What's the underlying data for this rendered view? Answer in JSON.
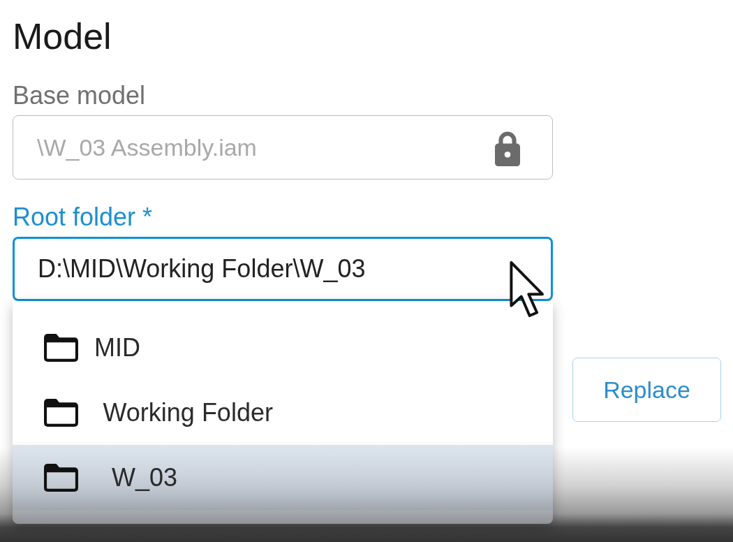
{
  "section": {
    "title": "Model"
  },
  "fields": [
    {
      "label": "Base model",
      "value": "\\W_03 Assembly.iam",
      "disabled": true,
      "focused": false
    },
    {
      "label": "Root folder *",
      "value": "D:\\MID\\Working Folder\\W_03",
      "disabled": false,
      "focused": true,
      "dropdown": {
        "items": [
          {
            "label": "MID",
            "selected": false,
            "children": [
              {
                "label": "Working Folder",
                "selected": false,
                "children": [
                  {
                    "label": "W_03",
                    "selected": true
                  }
                ]
              }
            ]
          }
        ]
      }
    }
  ],
  "actions": [
    {
      "label": "Replace"
    }
  ]
}
